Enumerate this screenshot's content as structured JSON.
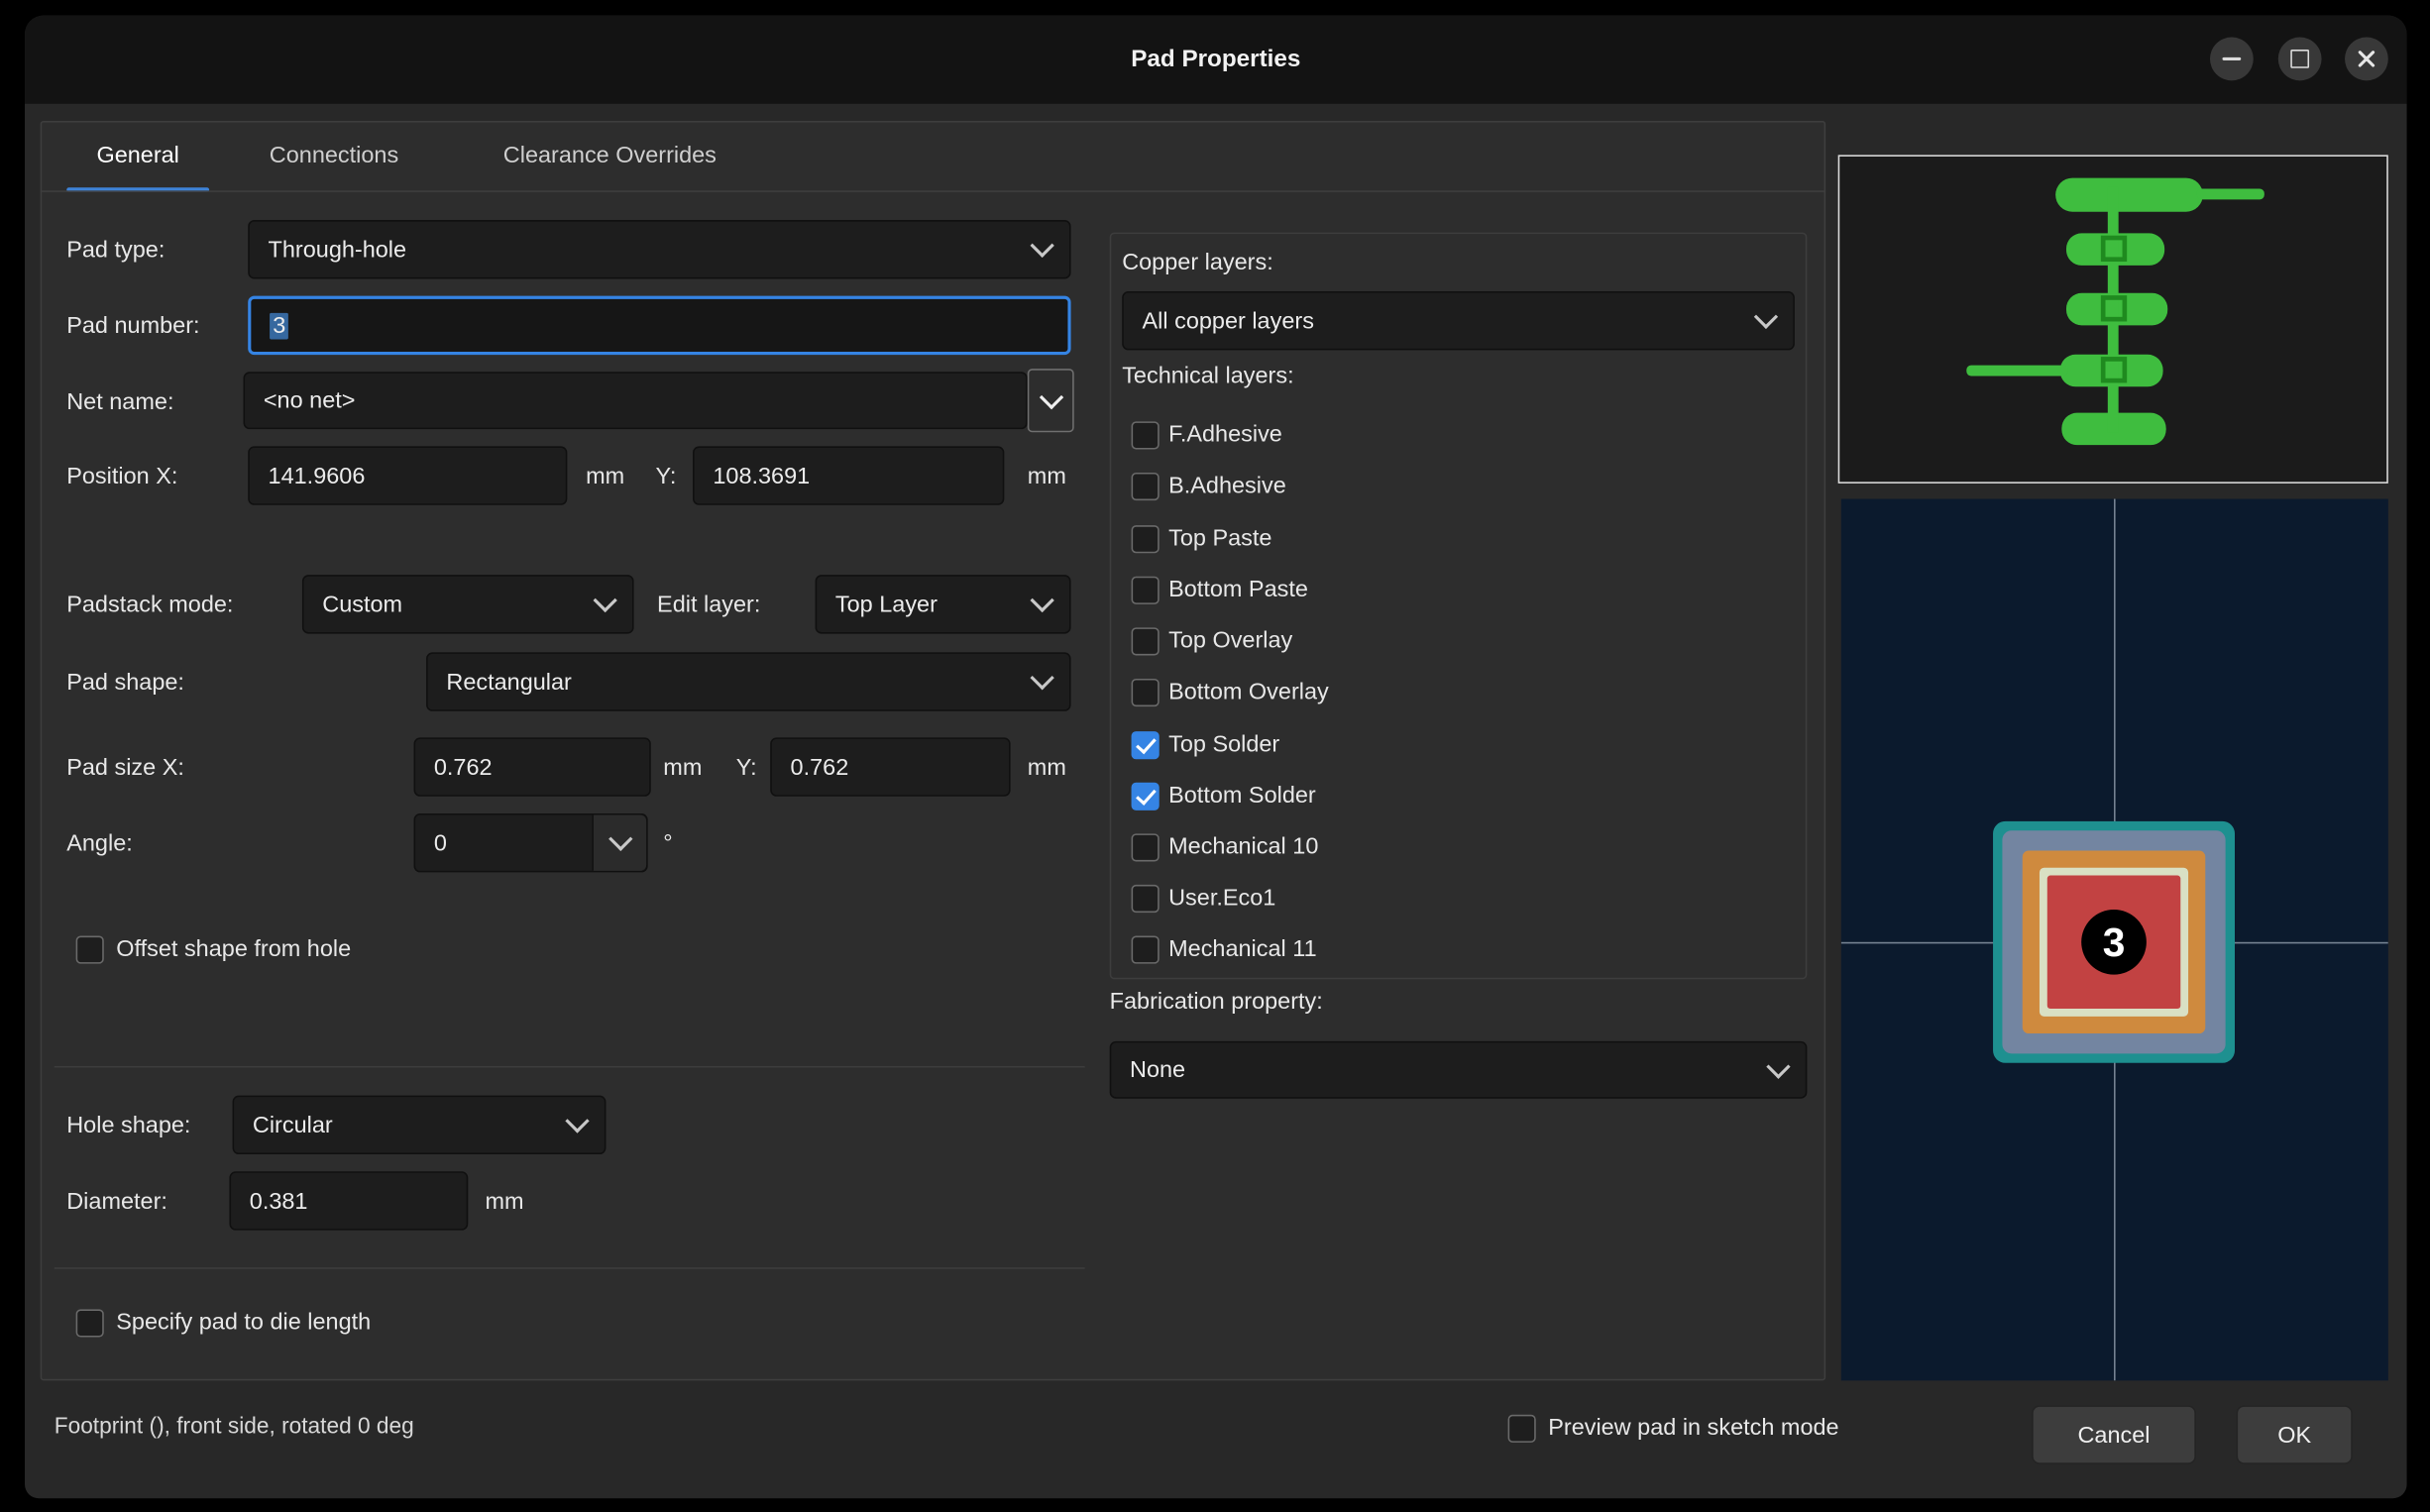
{
  "window": {
    "title": "Pad Properties"
  },
  "tabs": {
    "general": "General",
    "connections": "Connections",
    "clearance": "Clearance Overrides"
  },
  "form": {
    "pad_type_label": "Pad type:",
    "pad_type_value": "Through-hole",
    "pad_number_label": "Pad number:",
    "pad_number_value": "3",
    "net_name_label": "Net name:",
    "net_name_value": "<no net>",
    "position_label": "Position X:",
    "position_x": "141.9606",
    "position_x_unit": "mm",
    "position_y_label": "Y:",
    "position_y": "108.3691",
    "position_y_unit": "mm",
    "padstack_mode_label": "Padstack mode:",
    "padstack_mode_value": "Custom",
    "edit_layer_label": "Edit layer:",
    "edit_layer_value": "Top Layer",
    "pad_shape_label": "Pad shape:",
    "pad_shape_value": "Rectangular",
    "pad_size_label": "Pad size X:",
    "pad_size_x": "0.762",
    "pad_size_x_unit": "mm",
    "pad_size_y_label": "Y:",
    "pad_size_y": "0.762",
    "pad_size_y_unit": "mm",
    "angle_label": "Angle:",
    "angle_value": "0",
    "angle_unit": "°",
    "offset_checkbox": {
      "label": "Offset shape from hole",
      "checked": false
    },
    "hole_shape_label": "Hole shape:",
    "hole_shape_value": "Circular",
    "diameter_label": "Diameter:",
    "diameter_value": "0.381",
    "diameter_unit": "mm",
    "die_checkbox": {
      "label": "Specify pad to die length",
      "checked": false
    }
  },
  "layers": {
    "copper_label": "Copper layers:",
    "copper_value": "All copper layers",
    "technical_label": "Technical layers:",
    "items": [
      {
        "label": "F.Adhesive",
        "checked": false
      },
      {
        "label": "B.Adhesive",
        "checked": false
      },
      {
        "label": "Top Paste",
        "checked": false
      },
      {
        "label": "Bottom Paste",
        "checked": false
      },
      {
        "label": "Top Overlay",
        "checked": false
      },
      {
        "label": "Bottom Overlay",
        "checked": false
      },
      {
        "label": "Top Solder",
        "checked": true
      },
      {
        "label": "Bottom Solder",
        "checked": true
      },
      {
        "label": "Mechanical 10",
        "checked": false
      },
      {
        "label": "User.Eco1",
        "checked": false
      },
      {
        "label": "Mechanical 11",
        "checked": false
      }
    ],
    "fabrication_label": "Fabrication property:",
    "fabrication_value": "None"
  },
  "preview": {
    "pad_number": "3"
  },
  "footer": {
    "status": "Footprint (), front side, rotated 0 deg",
    "sketch_checkbox": {
      "label": "Preview pad in sketch mode",
      "checked": false
    },
    "cancel_label": "Cancel",
    "ok_label": "OK"
  },
  "colors": {
    "accent_blue": "#3584e4",
    "pad_green": "#3fbd3f",
    "preview_bg": "#0b1a2d",
    "pad_teal": "#1e9090",
    "pad_slate": "#7385a1",
    "pad_orange": "#cf8a3e",
    "pad_pale": "#d9e0c4",
    "pad_red": "#c24242"
  }
}
